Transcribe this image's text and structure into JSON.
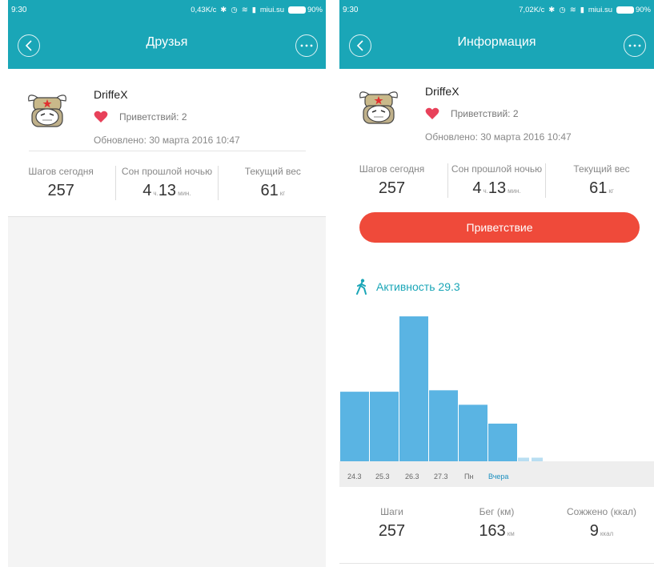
{
  "left": {
    "status": {
      "time": "9:30",
      "speed": "0,43K/с",
      "carrier": "miui.su",
      "battery": "90%"
    },
    "appbar": {
      "title": "Друзья"
    },
    "profile": {
      "name": "DriffeX",
      "likes": "Приветствий: 2",
      "updated": "Обновлено: 30 марта 2016 10:47"
    },
    "stats": [
      {
        "label": "Шагов сегодня",
        "value": "257",
        "unit": ""
      },
      {
        "label": "Сон прошлой ночью",
        "value": "4",
        "unit": "ч.",
        "value2": "13",
        "unit2": "мин."
      },
      {
        "label": "Текущий вес",
        "value": "61",
        "unit": "кг"
      }
    ]
  },
  "right": {
    "status": {
      "time": "9:30",
      "speed": "7,02K/с",
      "carrier": "miui.su",
      "battery": "90%"
    },
    "appbar": {
      "title": "Информация"
    },
    "profile": {
      "name": "DriffeX",
      "likes": "Приветствий: 2",
      "updated": "Обновлено: 30 марта 2016 10:47"
    },
    "stats": [
      {
        "label": "Шагов сегодня",
        "value": "257",
        "unit": ""
      },
      {
        "label": "Сон прошлой ночью",
        "value": "4",
        "unit": "ч.",
        "value2": "13",
        "unit2": "мин."
      },
      {
        "label": "Текущий вес",
        "value": "61",
        "unit": "кг"
      }
    ],
    "greet_button": "Приветствие",
    "activity_title": "Активность 29.3",
    "bottom_stats": [
      {
        "label": "Шаги",
        "value": "257",
        "unit": ""
      },
      {
        "label": "Бег (км)",
        "value": "163",
        "unit": "км"
      },
      {
        "label": "Сожжено (ккал)",
        "value": "9",
        "unit": "ккал"
      }
    ]
  },
  "colors": {
    "accent": "#1aa6b7",
    "button": "#ef4a3a",
    "bar": "#5ab4e3",
    "heart": "#e8415a"
  },
  "icons": {
    "back": "chevron-left-icon",
    "more": "more-dots-icon",
    "heart": "heart-icon",
    "walk": "walking-icon"
  },
  "chart_data": {
    "type": "bar",
    "categories": [
      "24.3",
      "25.3",
      "26.3",
      "27.3",
      "Пн",
      "Вчера"
    ],
    "values": [
      4.8,
      10.0,
      4.9,
      3.9,
      2.6,
      0.25
    ],
    "extra_leading_value": 4.8,
    "highlighted": "Вчера",
    "title": "",
    "ylim": [
      0,
      10.5
    ]
  }
}
